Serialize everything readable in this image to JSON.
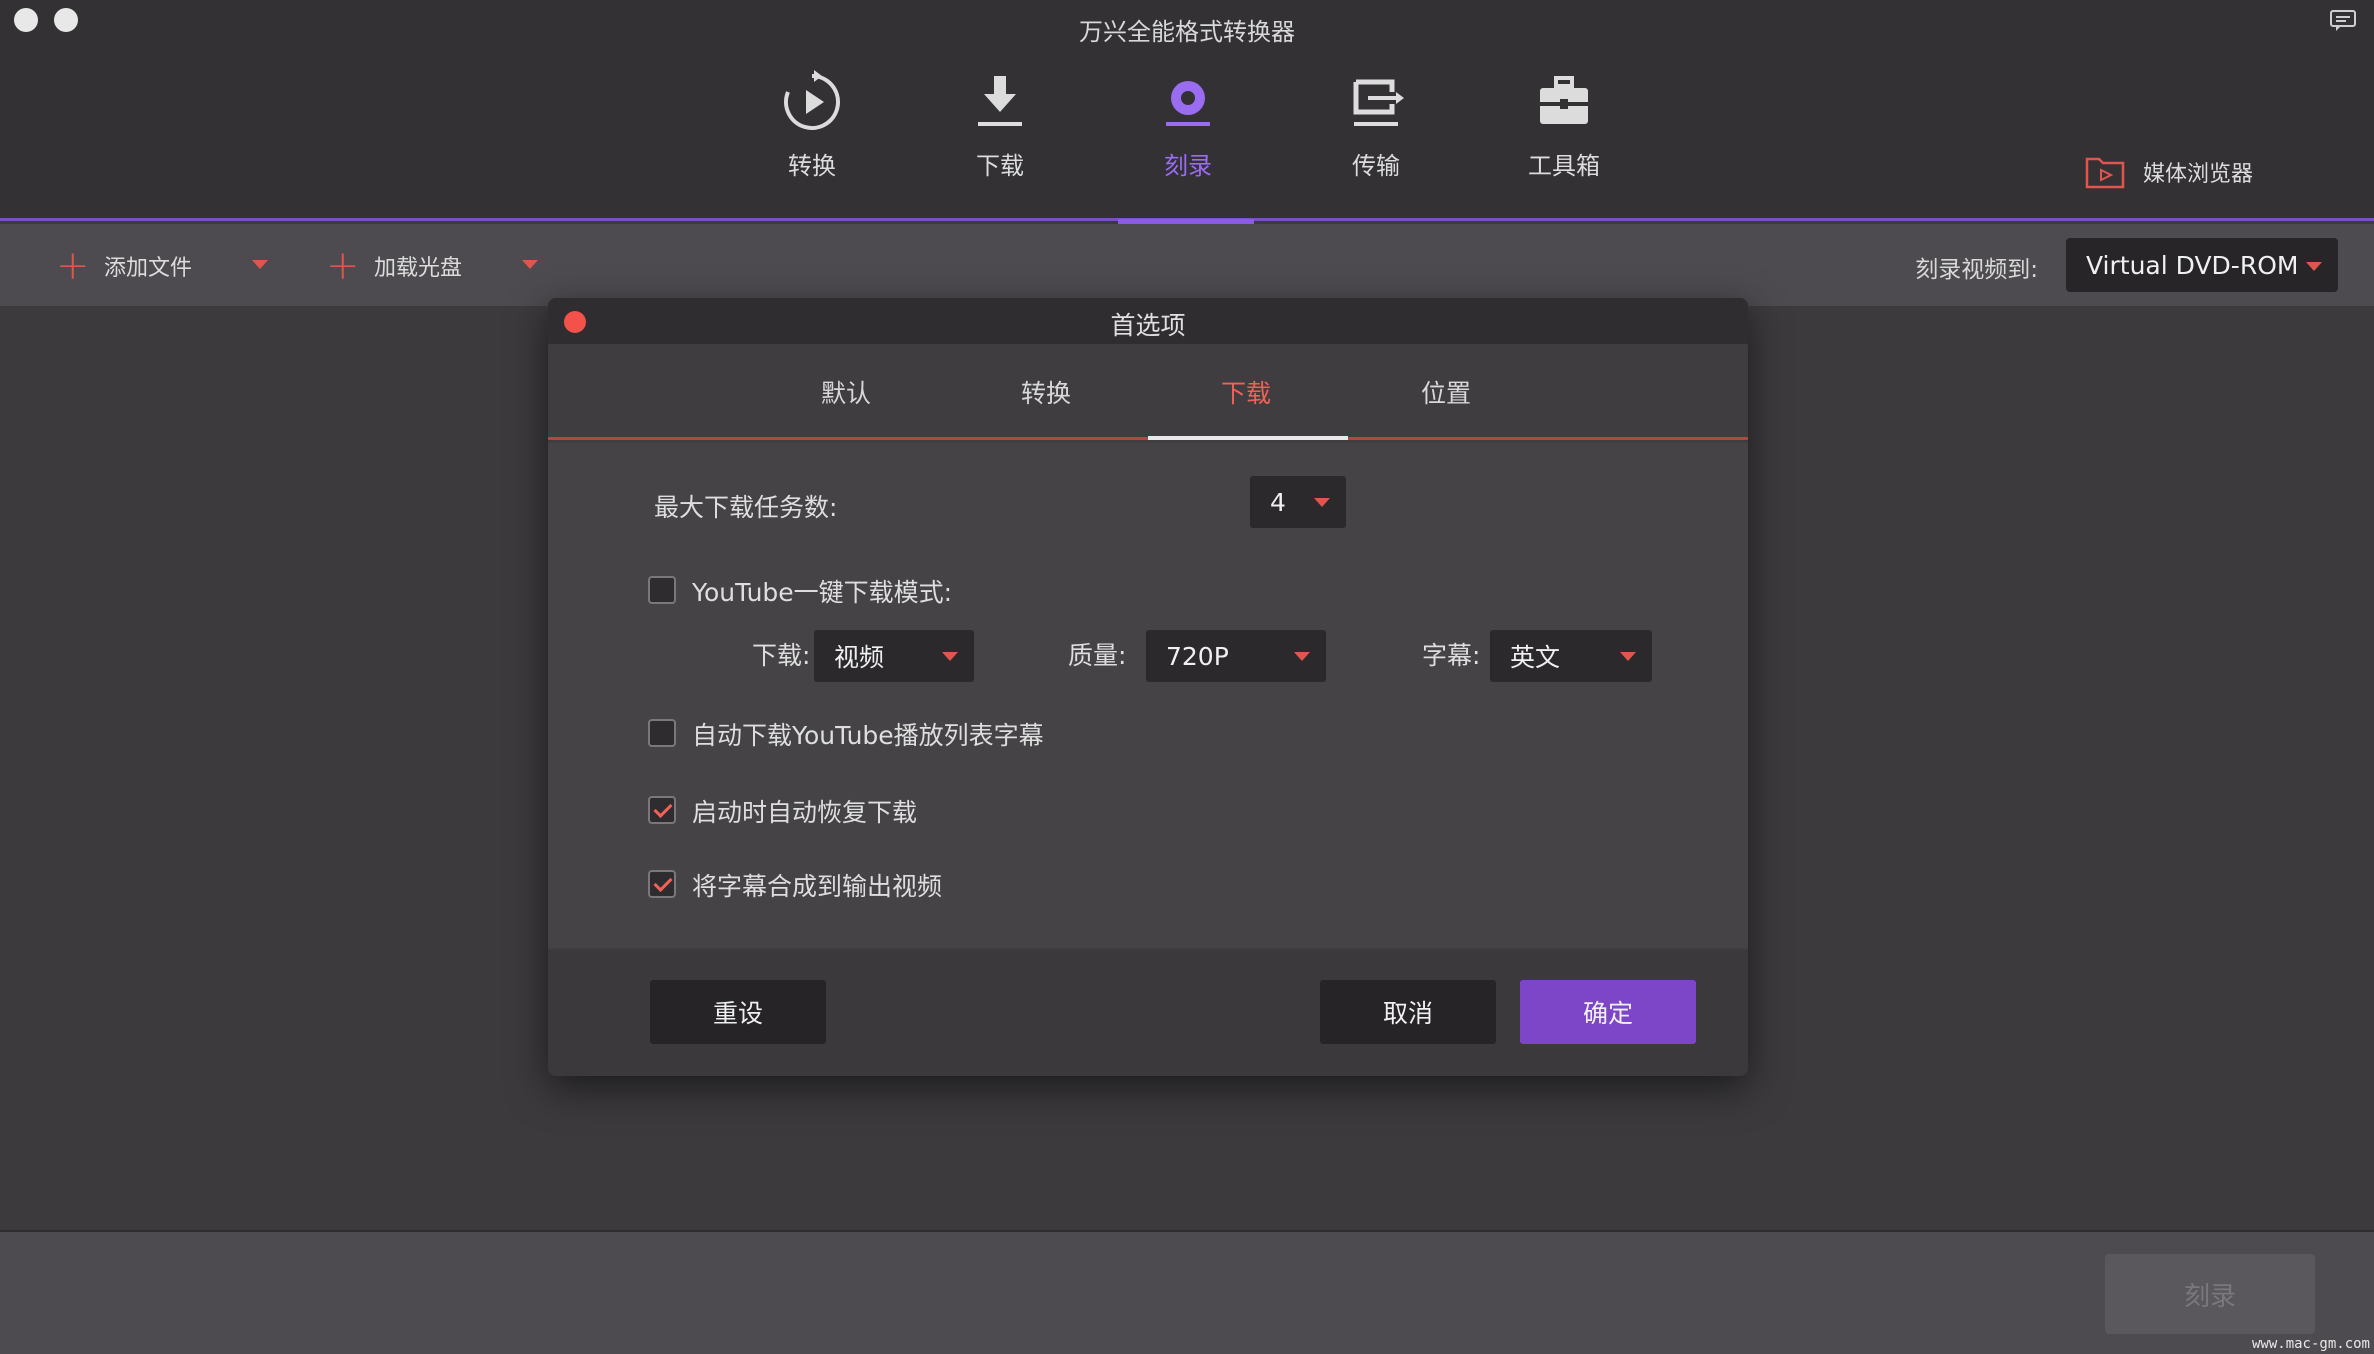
{
  "app": {
    "title": "万兴全能格式转换器"
  },
  "nav": {
    "items": [
      {
        "label": "转换",
        "icon": "convert-icon"
      },
      {
        "label": "下载",
        "icon": "download-icon"
      },
      {
        "label": "刻录",
        "icon": "burn-disc-icon",
        "active": true
      },
      {
        "label": "传输",
        "icon": "transfer-icon"
      },
      {
        "label": "工具箱",
        "icon": "toolbox-icon"
      }
    ],
    "media_browser": "媒体浏览器"
  },
  "toolbar": {
    "add_file": "添加文件",
    "load_disc": "加载光盘",
    "burn_to_label": "刻录视频到:",
    "burn_target": "Virtual DVD-ROM"
  },
  "dialog": {
    "title": "首选项",
    "tabs": [
      "默认",
      "转换",
      "下载",
      "位置"
    ],
    "active_tab": "下载",
    "max_tasks_label": "最大下载任务数:",
    "max_tasks_value": "4",
    "youtube_mode_label": "YouTube一键下载模式:",
    "youtube_mode_checked": false,
    "download_label": "下载:",
    "download_value": "视频",
    "quality_label": "质量:",
    "quality_value": "720P",
    "subtitle_label": "字幕:",
    "subtitle_value": "英文",
    "auto_playlist_subs_label": "自动下载YouTube播放列表字幕",
    "auto_playlist_subs_checked": false,
    "resume_on_start_label": "启动时自动恢复下载",
    "resume_on_start_checked": true,
    "merge_subs_label": "将字幕合成到输出视频",
    "merge_subs_checked": true,
    "reset_button": "重设",
    "cancel_button": "取消",
    "ok_button": "确定"
  },
  "bottom": {
    "burn_button": "刻录"
  },
  "watermark": "www.mac-gm.com",
  "colors": {
    "accent": "#8a5ce0",
    "highlight": "#f26157",
    "primary_button": "#7d46c8"
  }
}
